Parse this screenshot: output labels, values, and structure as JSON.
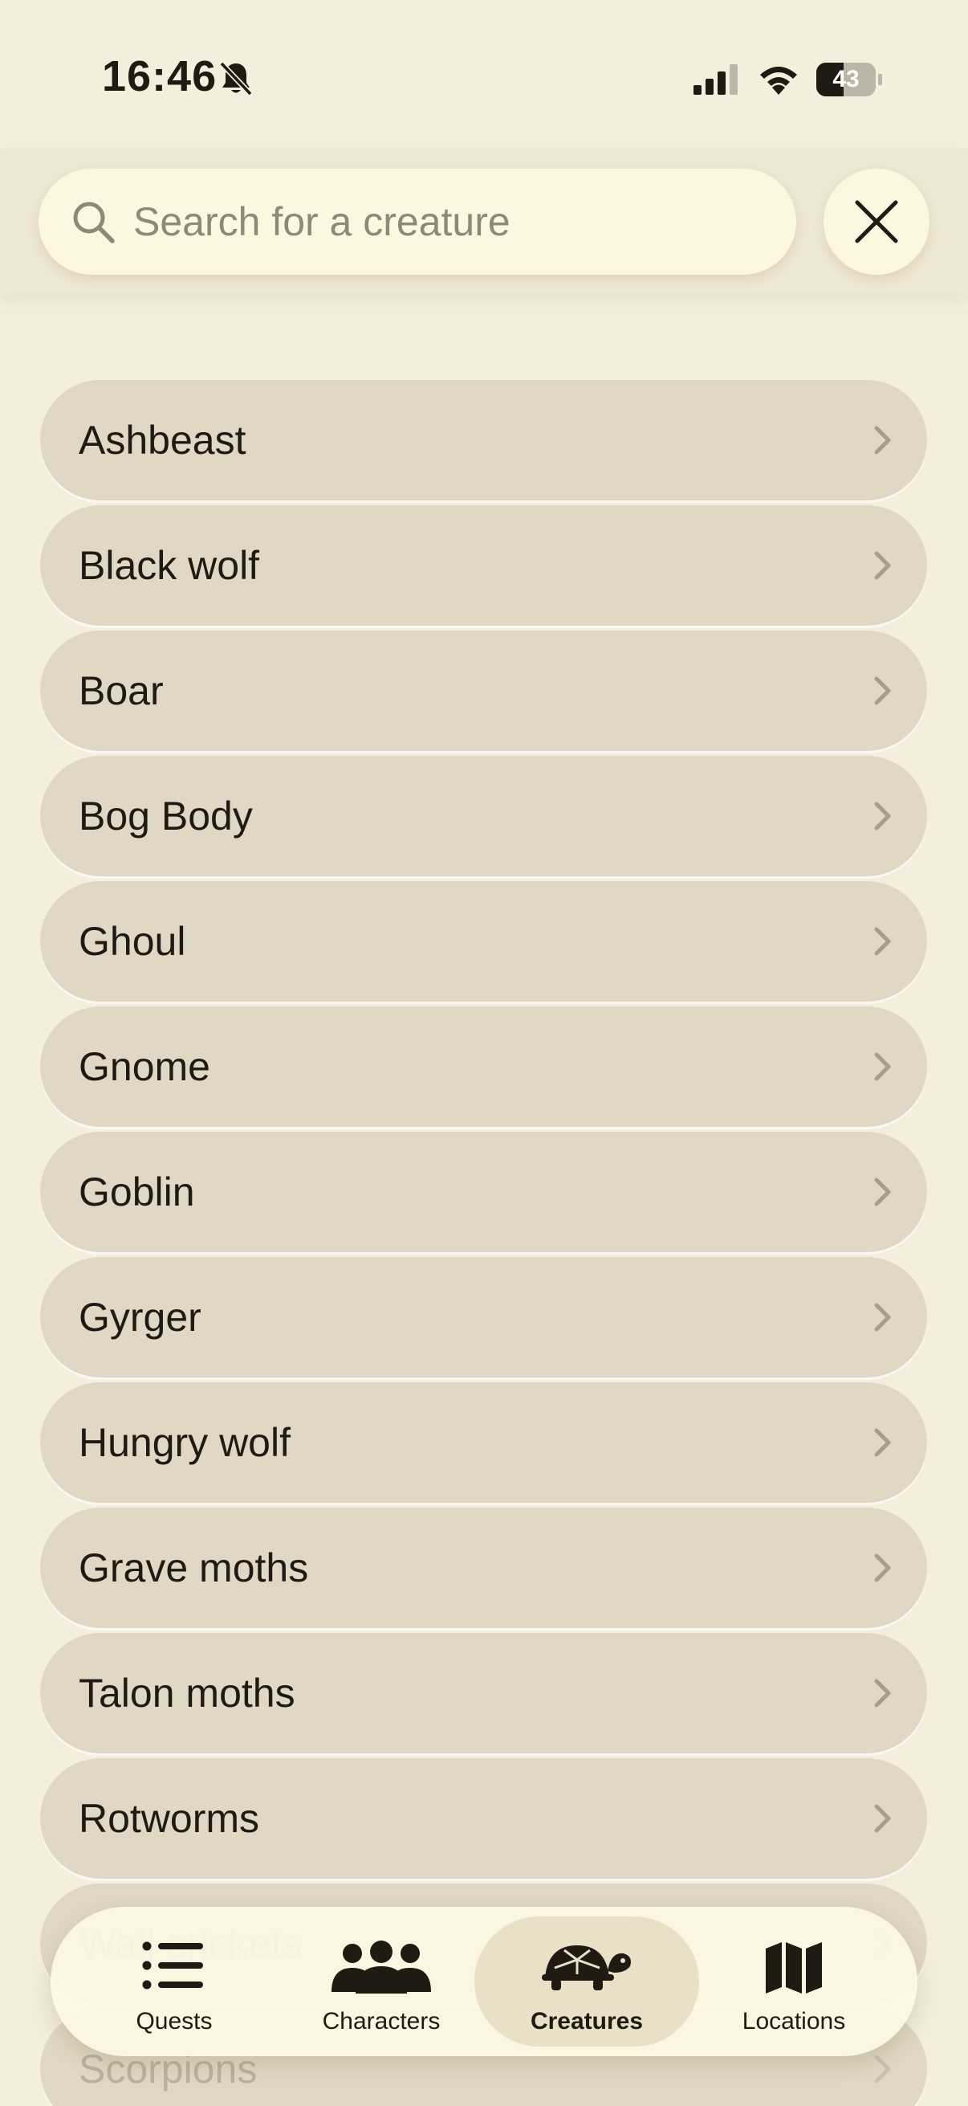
{
  "status_bar": {
    "time": "16:46",
    "battery": "43",
    "icons": [
      "bell-slash-icon",
      "cellular-signal-icon",
      "wifi-icon",
      "battery-icon"
    ]
  },
  "search": {
    "placeholder": "Search for a creature",
    "icon": "search-icon",
    "close_icon": "close-icon"
  },
  "creatures": [
    "Ashbeast",
    "Black wolf",
    "Boar",
    "Bog Body",
    "Ghoul",
    "Gnome",
    "Goblin",
    "Gyrger",
    "Hungry wolf",
    "Grave moths",
    "Talon moths",
    "Rotworms",
    "Wall crickets",
    "Scorpions"
  ],
  "tabs": [
    {
      "label": "Quests",
      "icon": "list-icon",
      "active": false
    },
    {
      "label": "Characters",
      "icon": "people-icon",
      "active": false
    },
    {
      "label": "Creatures",
      "icon": "turtle-icon",
      "active": true
    },
    {
      "label": "Locations",
      "icon": "map-icon",
      "active": false
    }
  ],
  "colors": {
    "background": "#f4eedd",
    "row": "#e0d8c5",
    "search_field": "#fdf7e2",
    "text": "#1f1a12",
    "active_tab": "#e8e1c8"
  }
}
